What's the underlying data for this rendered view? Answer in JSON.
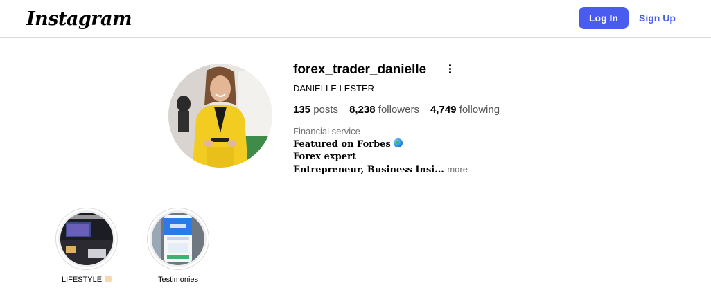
{
  "header": {
    "logo_text": "Instagram",
    "login_label": "Log In",
    "signup_label": "Sign Up"
  },
  "profile": {
    "username": "forex_trader_danielle",
    "full_name": "DANIELLE LESTER",
    "stats": {
      "posts_count": "135",
      "posts_label": "posts",
      "followers_count": "8,238",
      "followers_label": "followers",
      "following_count": "4,749",
      "following_label": "following"
    },
    "category": "Financial service",
    "bio": {
      "line1": "Featured on Forbes",
      "line2": "Forex expert",
      "line3": "Entrepreneur, Business Insi...",
      "more_label": "more"
    }
  },
  "highlights": [
    {
      "label": "LIFESTYLE"
    },
    {
      "label": "Testimonies"
    }
  ],
  "colors": {
    "accent": "#4a5cf0",
    "muted": "#737373",
    "border": "#dbdbdb"
  }
}
